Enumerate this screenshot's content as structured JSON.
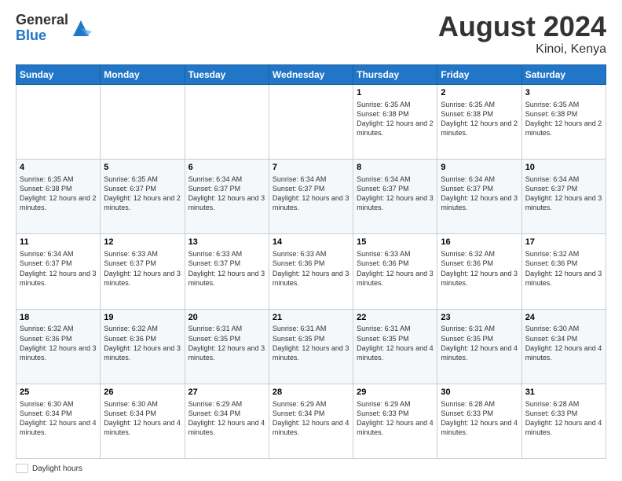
{
  "header": {
    "logo_general": "General",
    "logo_blue": "Blue",
    "month_year": "August 2024",
    "location": "Kinoi, Kenya"
  },
  "footer": {
    "daylight_label": "Daylight hours"
  },
  "days_of_week": [
    "Sunday",
    "Monday",
    "Tuesday",
    "Wednesday",
    "Thursday",
    "Friday",
    "Saturday"
  ],
  "weeks": [
    [
      {
        "num": "",
        "info": ""
      },
      {
        "num": "",
        "info": ""
      },
      {
        "num": "",
        "info": ""
      },
      {
        "num": "",
        "info": ""
      },
      {
        "num": "1",
        "info": "Sunrise: 6:35 AM\nSunset: 6:38 PM\nDaylight: 12 hours and 2 minutes."
      },
      {
        "num": "2",
        "info": "Sunrise: 6:35 AM\nSunset: 6:38 PM\nDaylight: 12 hours and 2 minutes."
      },
      {
        "num": "3",
        "info": "Sunrise: 6:35 AM\nSunset: 6:38 PM\nDaylight: 12 hours and 2 minutes."
      }
    ],
    [
      {
        "num": "4",
        "info": "Sunrise: 6:35 AM\nSunset: 6:38 PM\nDaylight: 12 hours and 2 minutes."
      },
      {
        "num": "5",
        "info": "Sunrise: 6:35 AM\nSunset: 6:37 PM\nDaylight: 12 hours and 2 minutes."
      },
      {
        "num": "6",
        "info": "Sunrise: 6:34 AM\nSunset: 6:37 PM\nDaylight: 12 hours and 3 minutes."
      },
      {
        "num": "7",
        "info": "Sunrise: 6:34 AM\nSunset: 6:37 PM\nDaylight: 12 hours and 3 minutes."
      },
      {
        "num": "8",
        "info": "Sunrise: 6:34 AM\nSunset: 6:37 PM\nDaylight: 12 hours and 3 minutes."
      },
      {
        "num": "9",
        "info": "Sunrise: 6:34 AM\nSunset: 6:37 PM\nDaylight: 12 hours and 3 minutes."
      },
      {
        "num": "10",
        "info": "Sunrise: 6:34 AM\nSunset: 6:37 PM\nDaylight: 12 hours and 3 minutes."
      }
    ],
    [
      {
        "num": "11",
        "info": "Sunrise: 6:34 AM\nSunset: 6:37 PM\nDaylight: 12 hours and 3 minutes."
      },
      {
        "num": "12",
        "info": "Sunrise: 6:33 AM\nSunset: 6:37 PM\nDaylight: 12 hours and 3 minutes."
      },
      {
        "num": "13",
        "info": "Sunrise: 6:33 AM\nSunset: 6:37 PM\nDaylight: 12 hours and 3 minutes."
      },
      {
        "num": "14",
        "info": "Sunrise: 6:33 AM\nSunset: 6:36 PM\nDaylight: 12 hours and 3 minutes."
      },
      {
        "num": "15",
        "info": "Sunrise: 6:33 AM\nSunset: 6:36 PM\nDaylight: 12 hours and 3 minutes."
      },
      {
        "num": "16",
        "info": "Sunrise: 6:32 AM\nSunset: 6:36 PM\nDaylight: 12 hours and 3 minutes."
      },
      {
        "num": "17",
        "info": "Sunrise: 6:32 AM\nSunset: 6:36 PM\nDaylight: 12 hours and 3 minutes."
      }
    ],
    [
      {
        "num": "18",
        "info": "Sunrise: 6:32 AM\nSunset: 6:36 PM\nDaylight: 12 hours and 3 minutes."
      },
      {
        "num": "19",
        "info": "Sunrise: 6:32 AM\nSunset: 6:36 PM\nDaylight: 12 hours and 3 minutes."
      },
      {
        "num": "20",
        "info": "Sunrise: 6:31 AM\nSunset: 6:35 PM\nDaylight: 12 hours and 3 minutes."
      },
      {
        "num": "21",
        "info": "Sunrise: 6:31 AM\nSunset: 6:35 PM\nDaylight: 12 hours and 3 minutes."
      },
      {
        "num": "22",
        "info": "Sunrise: 6:31 AM\nSunset: 6:35 PM\nDaylight: 12 hours and 4 minutes."
      },
      {
        "num": "23",
        "info": "Sunrise: 6:31 AM\nSunset: 6:35 PM\nDaylight: 12 hours and 4 minutes."
      },
      {
        "num": "24",
        "info": "Sunrise: 6:30 AM\nSunset: 6:34 PM\nDaylight: 12 hours and 4 minutes."
      }
    ],
    [
      {
        "num": "25",
        "info": "Sunrise: 6:30 AM\nSunset: 6:34 PM\nDaylight: 12 hours and 4 minutes."
      },
      {
        "num": "26",
        "info": "Sunrise: 6:30 AM\nSunset: 6:34 PM\nDaylight: 12 hours and 4 minutes."
      },
      {
        "num": "27",
        "info": "Sunrise: 6:29 AM\nSunset: 6:34 PM\nDaylight: 12 hours and 4 minutes."
      },
      {
        "num": "28",
        "info": "Sunrise: 6:29 AM\nSunset: 6:34 PM\nDaylight: 12 hours and 4 minutes."
      },
      {
        "num": "29",
        "info": "Sunrise: 6:29 AM\nSunset: 6:33 PM\nDaylight: 12 hours and 4 minutes."
      },
      {
        "num": "30",
        "info": "Sunrise: 6:28 AM\nSunset: 6:33 PM\nDaylight: 12 hours and 4 minutes."
      },
      {
        "num": "31",
        "info": "Sunrise: 6:28 AM\nSunset: 6:33 PM\nDaylight: 12 hours and 4 minutes."
      }
    ]
  ]
}
